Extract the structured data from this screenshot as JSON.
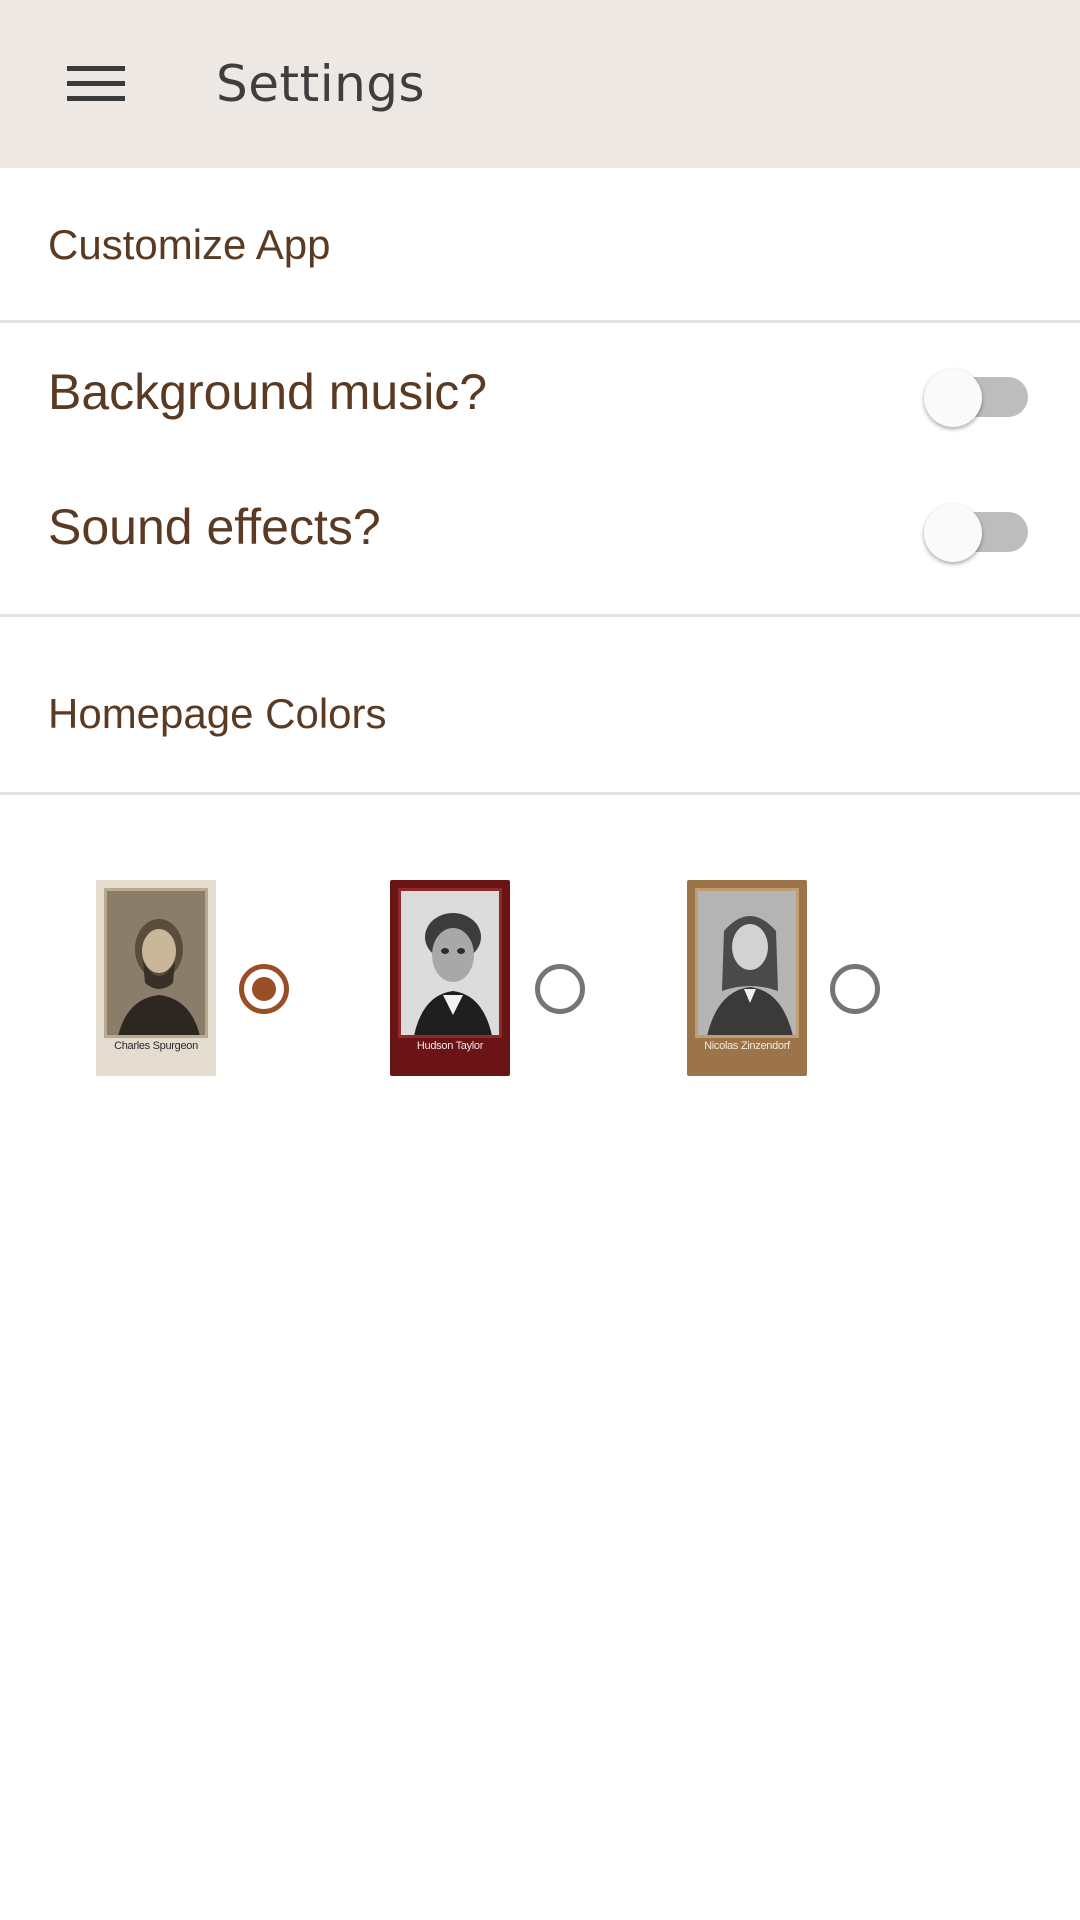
{
  "header": {
    "title": "Settings",
    "menu_icon": "hamburger-menu-icon",
    "background": "#ede8e4"
  },
  "sections": {
    "customize": {
      "title": "Customize App"
    },
    "homepage": {
      "title": "Homepage Colors"
    }
  },
  "preferences": [
    {
      "label": "Background music?",
      "enabled": false
    },
    {
      "label": "Sound effects?",
      "enabled": false
    }
  ],
  "themes": [
    {
      "caption": "Charles Spurgeon",
      "selected": true,
      "card_color": "#e3dccf",
      "caption_color": "#2b2b2b"
    },
    {
      "caption": "Hudson Taylor",
      "selected": false,
      "card_color": "#6b1416",
      "caption_color": "#f3e6e6"
    },
    {
      "caption": "Nicolas Zinzendorf",
      "selected": false,
      "card_color": "#9c7449",
      "caption_color": "#f5eadc"
    }
  ],
  "colors": {
    "text_brown": "#5a3a22",
    "radio_selected": "#9a4e26",
    "radio_unselected": "#757575"
  }
}
